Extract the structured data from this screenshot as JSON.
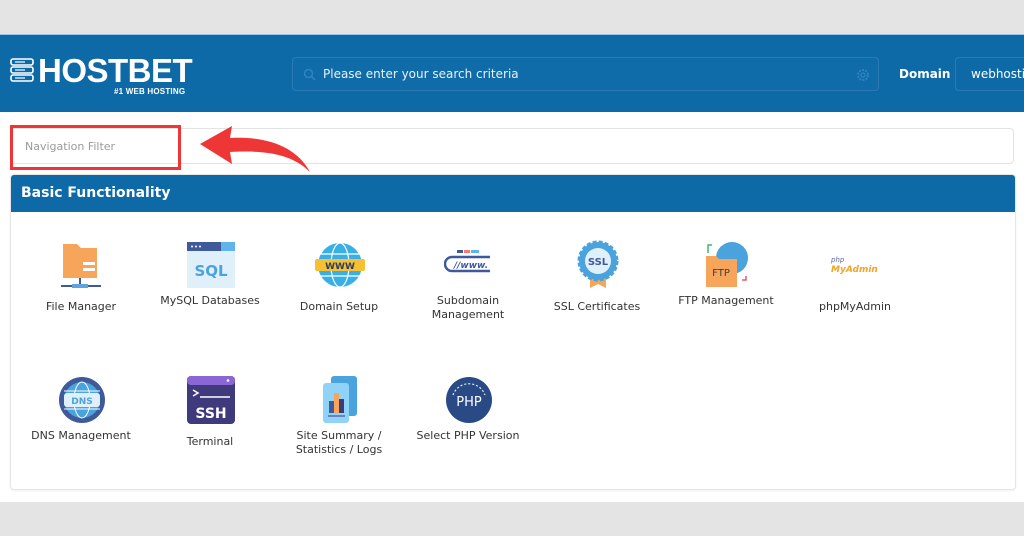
{
  "header": {
    "brand": "HOSTBET",
    "tagline": "#1 WEB HOSTING",
    "search_placeholder": "Please enter your search criteria",
    "domain_label": "Domain",
    "domain_value": "webhosting"
  },
  "nav_filter": {
    "placeholder": "Navigation Filter"
  },
  "annotation": {
    "highlight_color": "#ee3636"
  },
  "colors": {
    "brand_blue": "#0e6aa7"
  },
  "section": {
    "title": "Basic Functionality",
    "items": [
      {
        "label": "File Manager",
        "icon": "file-manager-icon"
      },
      {
        "label": "MySQL Databases",
        "icon": "mysql-icon"
      },
      {
        "label": "Domain Setup",
        "icon": "www-globe-icon"
      },
      {
        "label": "Subdomain Management",
        "icon": "subdomain-icon"
      },
      {
        "label": "SSL Certificates",
        "icon": "ssl-badge-icon"
      },
      {
        "label": "FTP Management",
        "icon": "ftp-icon"
      },
      {
        "label": "phpMyAdmin",
        "icon": "phpmyadmin-icon"
      },
      {
        "label": "DNS Management",
        "icon": "dns-globe-icon"
      },
      {
        "label": "Terminal",
        "icon": "ssh-terminal-icon"
      },
      {
        "label": "Site Summary / Statistics / Logs",
        "icon": "statistics-icon"
      },
      {
        "label": "Select PHP Version",
        "icon": "php-version-icon"
      }
    ]
  },
  "icon_text": {
    "sql": "SQL",
    "www": "WWW",
    "sub_www": "//www.",
    "ssl": "SSL",
    "ftp": "FTP",
    "php_small": "php",
    "myadmin": "MyAdmin",
    "dns": "DNS",
    "ssh": "SSH",
    "php": "PHP"
  }
}
